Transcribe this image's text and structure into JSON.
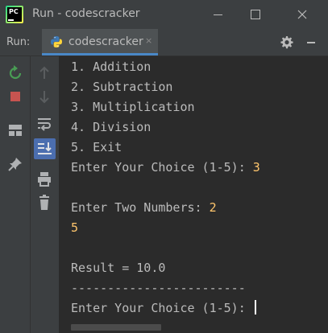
{
  "window": {
    "title": "Run - codescracker",
    "icon_text": "PC"
  },
  "run_panel": {
    "label": "Run:",
    "tab_label": "codescracker",
    "tab_close": "×"
  },
  "icons": {
    "app": "pycharm-icon",
    "python": "python-icon",
    "settings": "gear-icon",
    "rerun": "rerun-icon",
    "stop": "stop-icon",
    "layout": "layout-icon",
    "pin": "pin-icon",
    "up": "arrow-up-icon",
    "down": "arrow-down-icon",
    "soft_wrap": "soft-wrap-icon",
    "scroll_end": "scroll-to-end-icon",
    "print": "print-icon",
    "delete": "trash-icon"
  },
  "colors": {
    "accent": "#4a88c7",
    "input_text": "#ffc66d",
    "console_text": "#bbbbbb",
    "background": "#2b2b2b"
  },
  "console": {
    "menu": [
      "1. Addition",
      "2. Subtraction",
      "3. Multiplication",
      "4. Division",
      "5. Exit"
    ],
    "prompt_choice": "Enter Your Choice (1-5): ",
    "choice_input": "3",
    "prompt_numbers": "Enter Two Numbers: ",
    "first_number": "2",
    "second_number": "5",
    "result": "Result = 10.0",
    "separator": "------------------------",
    "prompt_choice_again": "Enter Your Choice (1-5): "
  }
}
